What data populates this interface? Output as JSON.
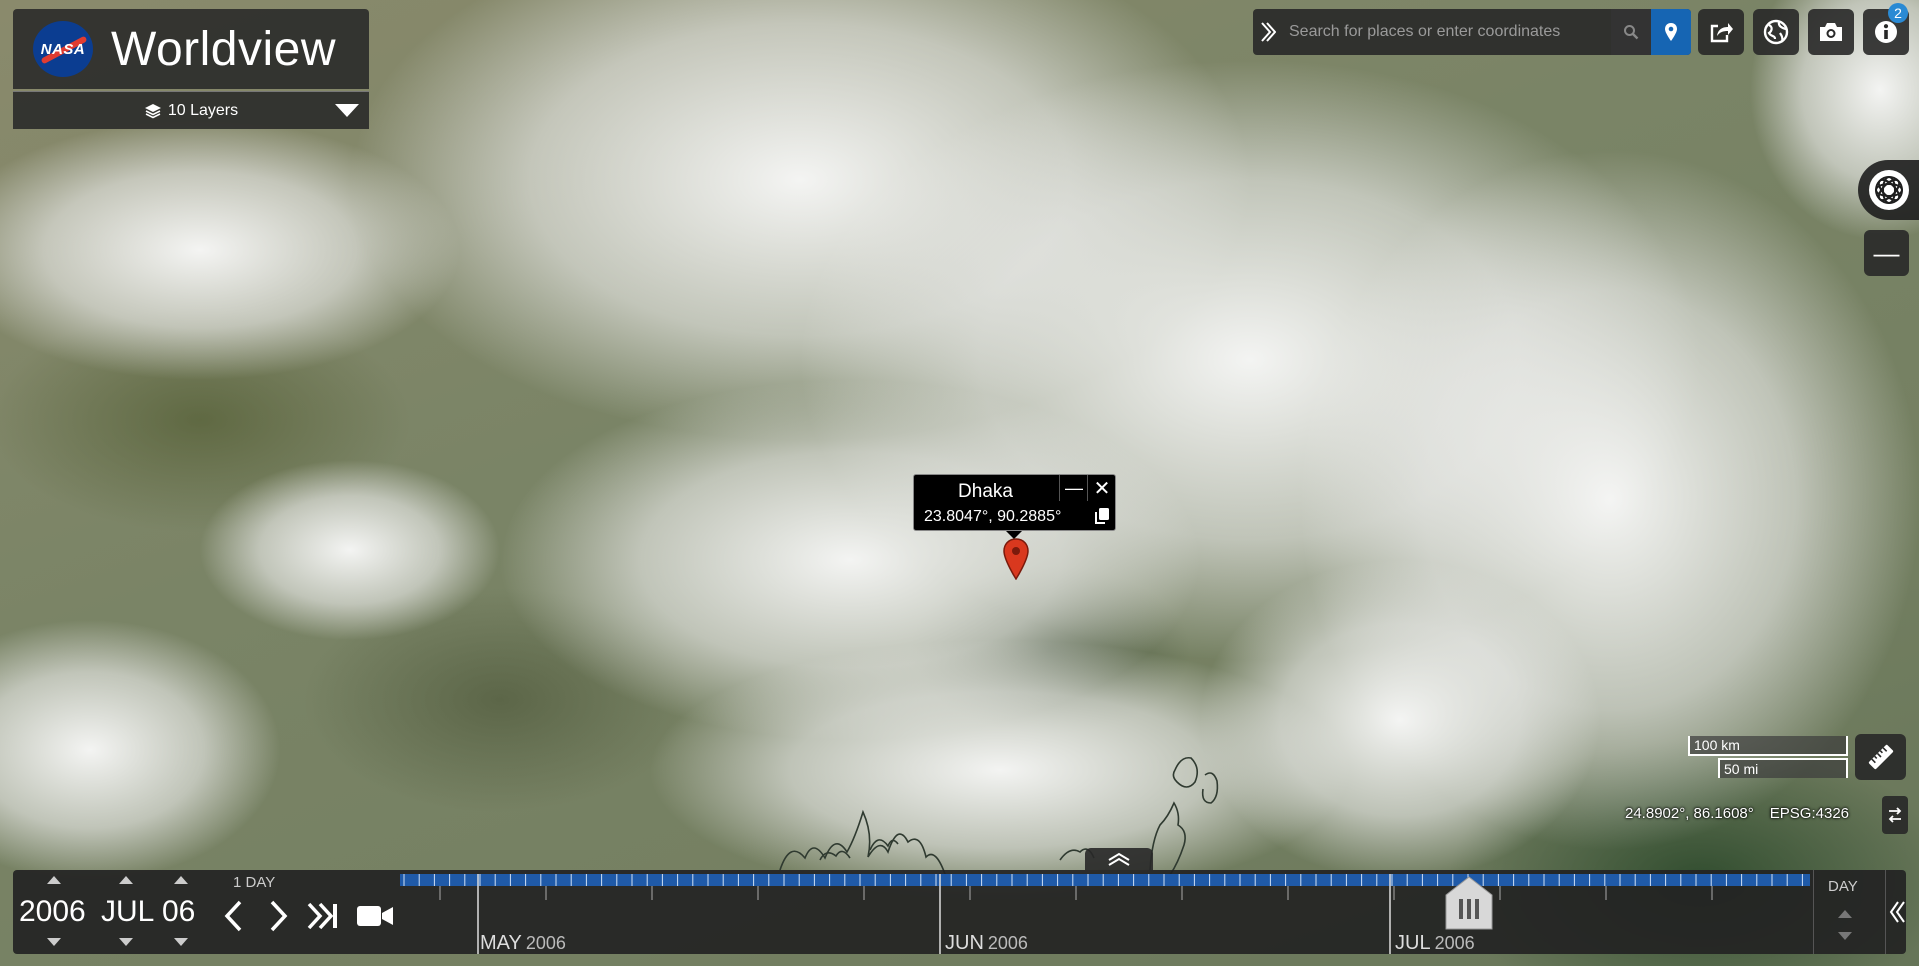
{
  "app": {
    "brand_logo": "NASA",
    "title": "Worldview",
    "layers_label": "10 Layers"
  },
  "toolbar": {
    "search_placeholder": "Search for places or enter coordinates",
    "info_badge_count": "2",
    "icons": [
      "expand-icon",
      "search-icon",
      "location-pin-icon",
      "share-icon",
      "projection-globe-icon",
      "camera-icon",
      "info-icon"
    ]
  },
  "popup": {
    "place_name": "Dhaka",
    "coordinates": "23.8047°, 90.2885°",
    "minimize_glyph": "—",
    "close_glyph": "✕"
  },
  "scale": {
    "km_label": "100 km",
    "mi_label": "50 mi"
  },
  "coordinates_readout": {
    "value": "24.8902°, 86.1608°",
    "projection": "EPSG:4326"
  },
  "timeline": {
    "year": "2006",
    "month": "JUL",
    "day": "06",
    "interval": "1 DAY",
    "zoom_level": "DAY",
    "months": [
      {
        "name": "MAY",
        "year": "2006"
      },
      {
        "name": "JUN",
        "year": "2006"
      },
      {
        "name": "JUL",
        "year": "2006"
      }
    ]
  },
  "colors": {
    "accent_blue": "#1665b3",
    "timeline_band": "#1f5aa8",
    "marker_red": "#d9381e",
    "panel_bg": "#282828"
  }
}
